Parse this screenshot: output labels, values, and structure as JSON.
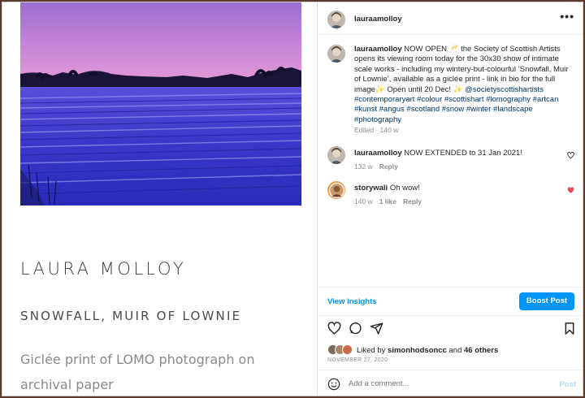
{
  "post": {
    "artist_name": "LAURA MOLLOY",
    "artwork_title": "SNOWFALL, MUIR OF LOWNIE",
    "medium": "Giclée print of LOMO photograph on archival paper",
    "image_alt": "snowy field at dusk, lomo photograph"
  },
  "header": {
    "username": "lauraamolloy",
    "more_icon": "more-horizontal-icon",
    "more_label": "•••"
  },
  "caption": {
    "username": "lauraamolloy",
    "text_1": "NOW OPEN 🥂 the Society of Scottish Artists opens its viewing room today for the 30x30 show of intimate scale works - including my wintery-but-colourful ‘Snowfall, Muir of Lownie’, available as a giclée print - link in bio for the full image✨ Open until 20 Dec! ✨",
    "mention": "@societyscottishartists",
    "hashtags": "#contemporaryart #colour #scottishart #lomography #artcan #kunst #angus #scotland #snow #winter #landscape #photography",
    "meta": "Edited · 140 w"
  },
  "comments": [
    {
      "username": "lauraamolloy",
      "text": "NOW EXTENDED to 31 Jan 2021!",
      "time": "132 w",
      "likes": "",
      "reply": "Reply",
      "liked": false,
      "heart_color": "#262626"
    },
    {
      "username": "storywali",
      "text": "Oh wow!",
      "time": "140 w",
      "likes": "1 like",
      "reply": "Reply",
      "liked": true,
      "heart_color": "#ed4956"
    }
  ],
  "actions": {
    "insights": "View Insights",
    "boost": "Boost Post"
  },
  "icons": [
    "heart-icon",
    "comment-icon",
    "share-icon",
    "bookmark-icon"
  ],
  "likes": {
    "prefix": "Liked by",
    "user": "simonhodsoncc",
    "middle": "and",
    "count": "46 others"
  },
  "date": "NOVEMBER 27, 2020",
  "comment_box": {
    "placeholder": "Add a comment...",
    "post": "Post"
  },
  "colors": {
    "accent": "#0095f6",
    "like_red": "#ed4956",
    "link": "#00376b",
    "muted": "#8e8e8e"
  }
}
